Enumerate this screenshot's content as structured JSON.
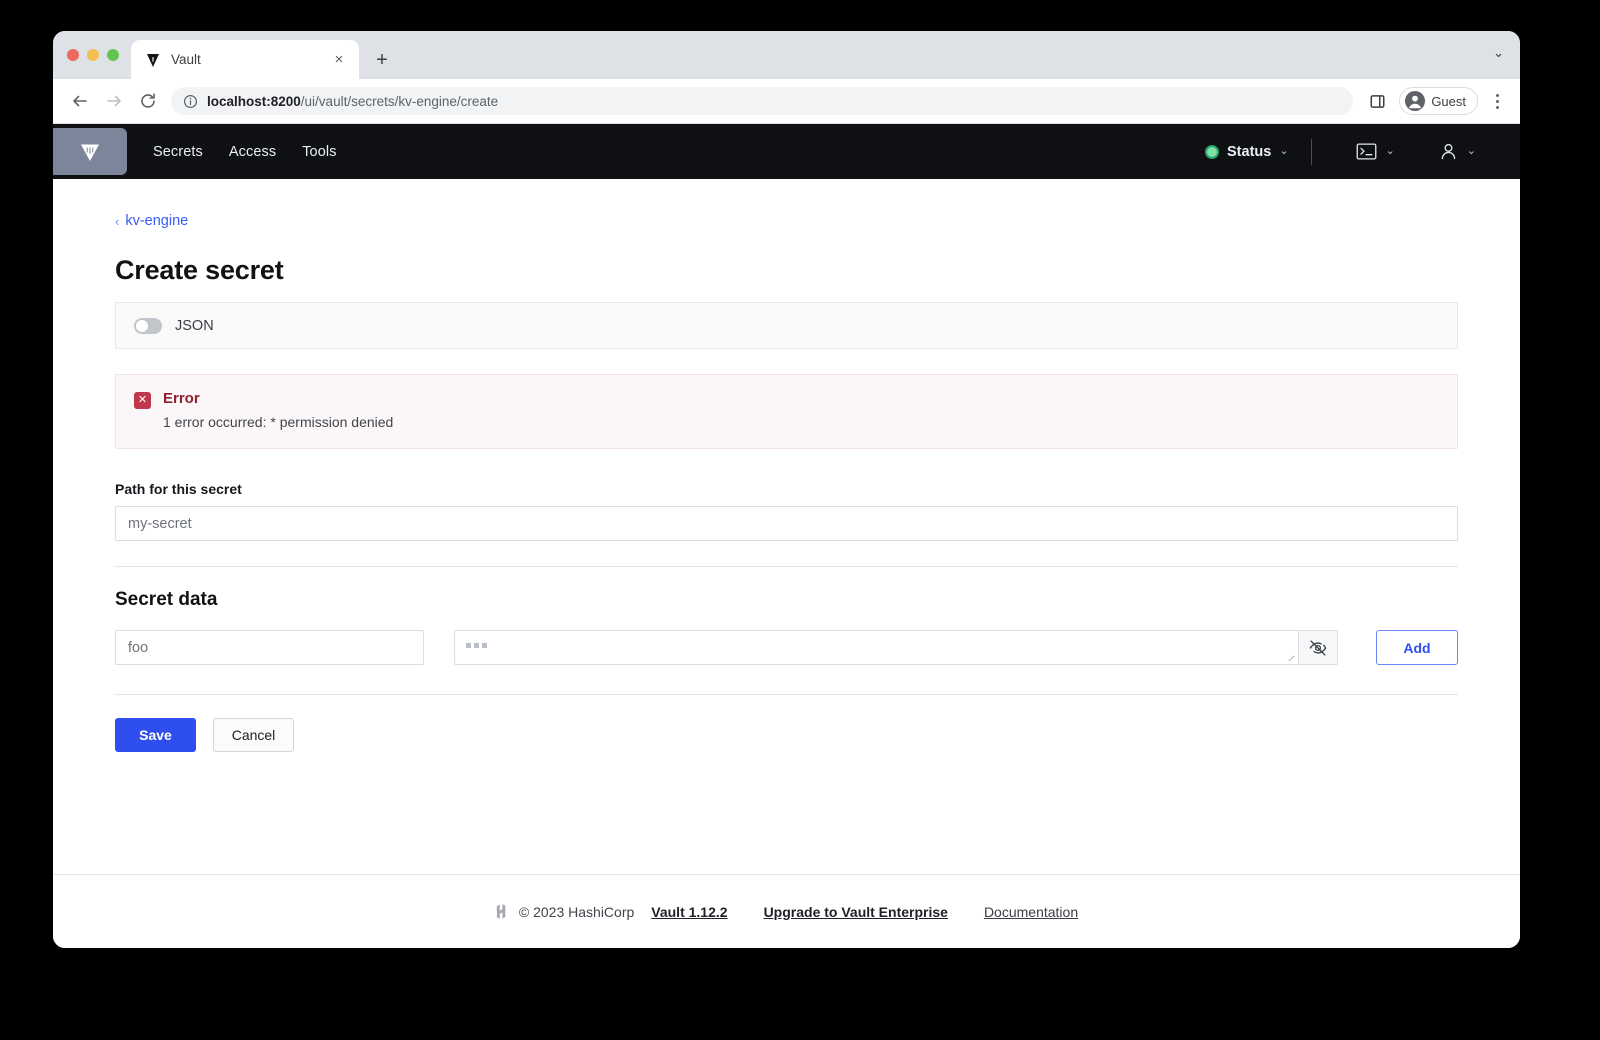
{
  "browser": {
    "tab": {
      "title": "Vault",
      "favicon": "vault-triangle-icon",
      "close_label": "×"
    },
    "new_tab_label": "+",
    "tabstrip_chevron": "⌄",
    "toolbar": {
      "back_icon": "←",
      "forward_icon": "→",
      "reload_icon": "↻",
      "info_icon": "site-info-icon",
      "url_prefix": "localhost:8200",
      "url_suffix": "/ui/vault/secrets/kv-engine/create",
      "url_full": "localhost:8200/ui/vault/secrets/kv-engine/create",
      "sidepanel_icon": "side-panel-icon",
      "profile_label": "Guest",
      "menu_icon": "kebab-menu-icon"
    }
  },
  "navbar": {
    "home_icon": "vault-logo-icon",
    "links": [
      {
        "label": "Secrets"
      },
      {
        "label": "Access"
      },
      {
        "label": "Tools"
      }
    ],
    "status": {
      "label": "Status",
      "dot_color": "#29a46c",
      "chevron": "⌄"
    },
    "console_icon": "console-terminal-icon",
    "console_chevron": "⌄",
    "user_icon": "user-account-icon",
    "user_chevron": "⌄"
  },
  "page": {
    "breadcrumb": {
      "chevron": "‹",
      "label": "kv-engine"
    },
    "title": "Create secret",
    "json_toggle": {
      "label": "JSON",
      "enabled": false
    },
    "error": {
      "icon_glyph": "✕",
      "title": "Error",
      "message": "1 error occurred: * permission denied"
    },
    "path_field": {
      "label": "Path for this secret",
      "value": "",
      "placeholder": "my-secret"
    },
    "secret_data": {
      "heading": "Secret data",
      "key_field": {
        "value": "",
        "placeholder": "foo"
      },
      "value_field": {
        "value": "",
        "placeholder": "•••",
        "masked": true,
        "toggle_icon": "eye-off-icon"
      },
      "add_label": "Add"
    },
    "actions": {
      "save_label": "Save",
      "cancel_label": "Cancel"
    }
  },
  "footer": {
    "logo_icon": "hashicorp-logo-icon",
    "copyright": "© 2023 HashiCorp",
    "links": [
      {
        "label": "Vault 1.12.2",
        "style": "bold"
      },
      {
        "label": "Upgrade to Vault Enterprise",
        "style": "bold"
      },
      {
        "label": "Documentation",
        "style": "plain"
      }
    ]
  },
  "colors": {
    "accent_blue": "#2f4ef0",
    "error_red": "#c0384b",
    "status_green": "#29a46c",
    "vault_nav_bg": "#0f1013"
  }
}
